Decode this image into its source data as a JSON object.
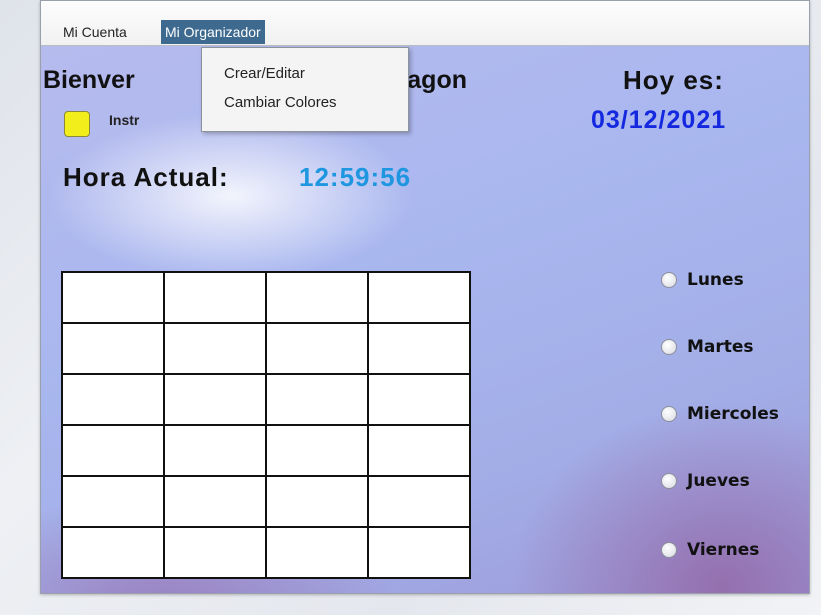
{
  "menubar": {
    "items": [
      {
        "label": "Mi Cuenta"
      },
      {
        "label": "Mi Organizador",
        "active": true
      }
    ]
  },
  "dropdown": {
    "items": [
      {
        "label": "Crear/Editar"
      },
      {
        "label": "Cambiar Colores"
      }
    ]
  },
  "header": {
    "welcome_visible_start": "Bienver",
    "welcome_visible_end": "ndragon",
    "today_label": "Hoy es:",
    "date": "03/12/2021",
    "instructions_visible": "Instr"
  },
  "clock": {
    "label": "Hora Actual:",
    "time": "12:59:56"
  },
  "schedule_grid": {
    "rows": 6,
    "columns": 4
  },
  "days": [
    {
      "label": "Lunes",
      "selected": false
    },
    {
      "label": "Martes",
      "selected": false
    },
    {
      "label": "Miercoles",
      "selected": false
    },
    {
      "label": "Jueves",
      "selected": false
    },
    {
      "label": "Viernes",
      "selected": false
    }
  ],
  "colors": {
    "menu_active_bg": "#3d6a8e",
    "date_color": "#1428e0",
    "time_color": "#1f97e0",
    "instructions_swatch": "#f2ee1c"
  }
}
